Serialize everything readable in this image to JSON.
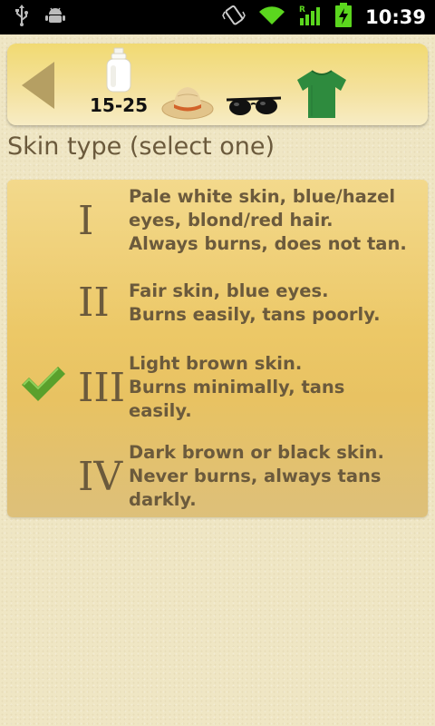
{
  "status_bar": {
    "time": "10:39",
    "icons": [
      "usb-icon",
      "android-debug-icon",
      "vibrate-icon",
      "wifi-icon",
      "signal-icon",
      "battery-charging-icon"
    ],
    "signal_badge": "R"
  },
  "toolbar": {
    "spf_label": "15-25",
    "buttons": [
      "back-icon",
      "sunscreen-bottle-icon",
      "sun-hat-icon",
      "sunglasses-icon",
      "tshirt-icon"
    ]
  },
  "heading": "Skin type (select one)",
  "skin_types": [
    {
      "numeral": "I",
      "line1": "Pale white skin, blue/hazel",
      "line2": "eyes, blond/red hair.",
      "line3": "Always burns, does not tan.",
      "selected": false
    },
    {
      "numeral": "II",
      "line1": "Fair skin, blue eyes.",
      "line2": "Burns easily, tans poorly.",
      "line3": "",
      "selected": false
    },
    {
      "numeral": "III",
      "line1": "Light brown skin.",
      "line2": "Burns minimally, tans",
      "line3": "easily.",
      "selected": true
    },
    {
      "numeral": "IV",
      "line1": "Dark brown or black skin.",
      "line2": "Never burns, always tans",
      "line3": "darkly.",
      "selected": false
    }
  ],
  "colors": {
    "text": "#6b5a3c",
    "checkmark": "#5aa02c",
    "shirt": "#2e8b3e",
    "toolbar_top": "#f1da72"
  }
}
